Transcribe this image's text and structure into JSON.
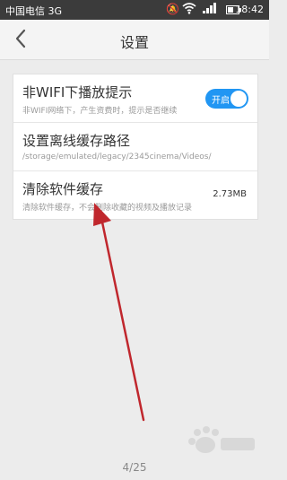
{
  "status_bar": {
    "carrier": "中国电信 3G",
    "time": "18:42",
    "icons": [
      "mute-icon",
      "wifi-icon",
      "signal-icon",
      "battery-icon"
    ]
  },
  "header": {
    "back_icon": "chevron-left-icon",
    "title": "设置"
  },
  "settings": {
    "items": [
      {
        "title": "非WIFI下播放提示",
        "subtitle": "非WIFI网络下，产生资费时，提示是否继续",
        "toggle_label": "开启",
        "toggle_on": true
      },
      {
        "title": "设置离线缓存路径",
        "subtitle": "/storage/emulated/legacy/2345cinema/Videos/"
      },
      {
        "title": "清除软件缓存",
        "subtitle": "清除软件缓存，不会删除收藏的视频及播放记录",
        "value": "2.73MB"
      }
    ]
  },
  "page_indicator": "4/25",
  "colors": {
    "toggle_on": "#2196f3",
    "annotation_arrow": "#c0272d",
    "status_bar": "#3b3b3b"
  }
}
